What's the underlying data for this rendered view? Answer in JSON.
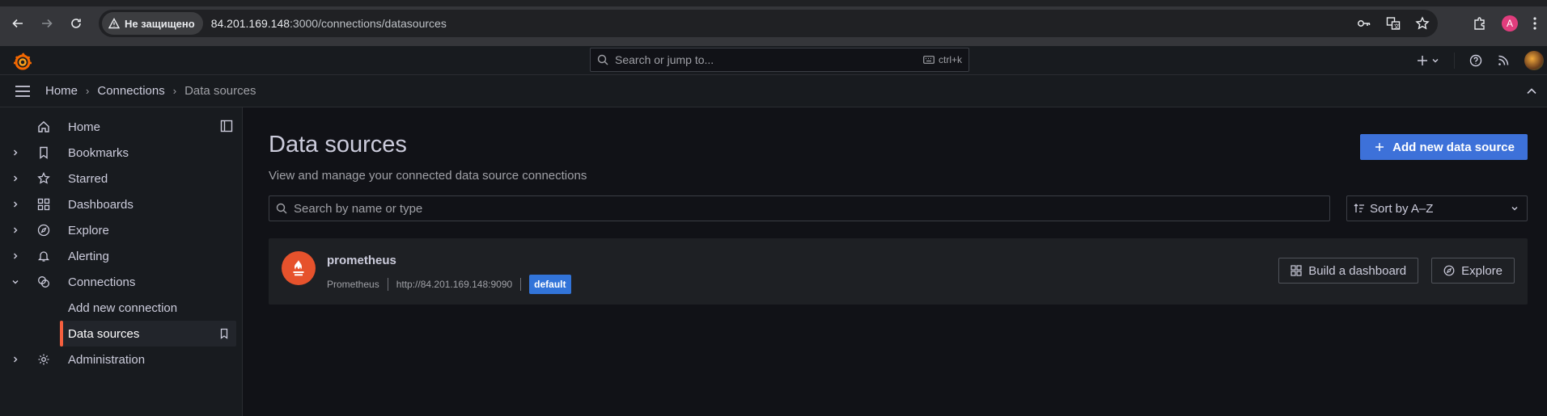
{
  "browser": {
    "security_label": "Не защищено",
    "url_host": "84.201.169.148",
    "url_path": ":3000/connections/datasources",
    "profile_initial": "A"
  },
  "topbar": {
    "search_placeholder": "Search or jump to...",
    "shortcut": "ctrl+k"
  },
  "breadcrumb": {
    "items": [
      "Home",
      "Connections",
      "Data sources"
    ]
  },
  "sidebar": {
    "items": [
      {
        "label": "Home",
        "icon": "home-icon"
      },
      {
        "label": "Bookmarks",
        "icon": "bookmark-icon"
      },
      {
        "label": "Starred",
        "icon": "star-icon"
      },
      {
        "label": "Dashboards",
        "icon": "apps-icon"
      },
      {
        "label": "Explore",
        "icon": "compass-icon"
      },
      {
        "label": "Alerting",
        "icon": "bell-icon"
      },
      {
        "label": "Connections",
        "icon": "link-icon"
      },
      {
        "label": "Add new connection"
      },
      {
        "label": "Data sources"
      },
      {
        "label": "Administration",
        "icon": "cog-icon"
      }
    ]
  },
  "page": {
    "title": "Data sources",
    "subtitle": "View and manage your connected data source connections",
    "add_button": "Add new data source",
    "search_placeholder": "Search by name or type",
    "sort_label": "Sort by A–Z"
  },
  "datasource": {
    "name": "prometheus",
    "type": "Prometheus",
    "url": "http://84.201.169.148:9090",
    "badge": "default",
    "build_button": "Build a dashboard",
    "explore_button": "Explore"
  },
  "colors": {
    "accent": "#3d71d9",
    "active_marker": "#f55f3e",
    "prometheus": "#e6522c"
  }
}
